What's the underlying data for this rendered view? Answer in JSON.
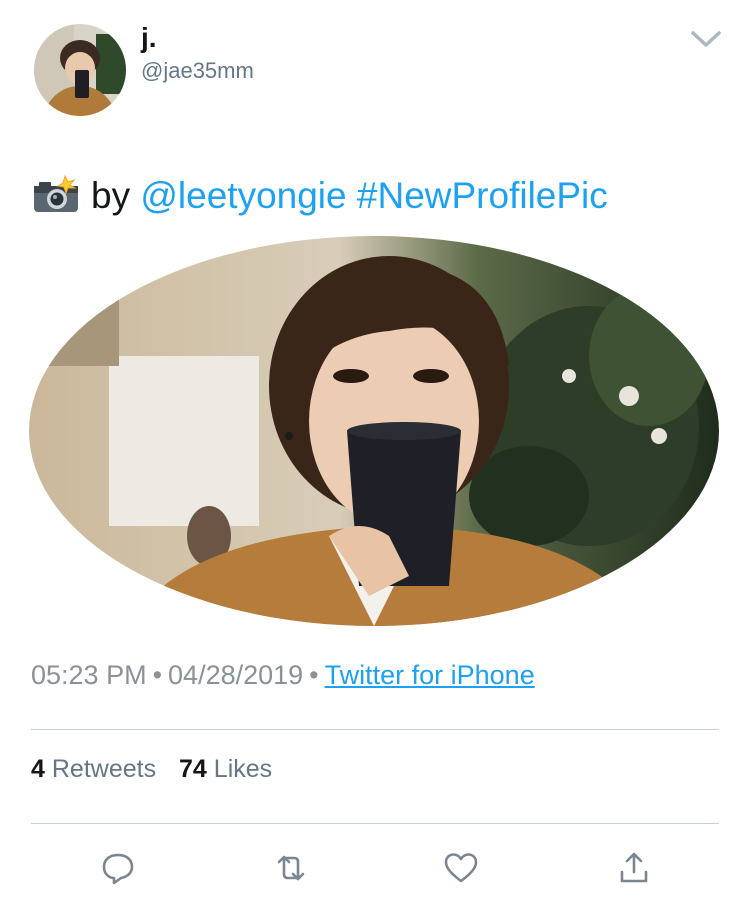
{
  "user": {
    "display_name": "j.",
    "handle": "@jae35mm"
  },
  "tweet": {
    "emoji": "camera-with-flash",
    "by_text": "by",
    "mention": "@leetyongie",
    "hashtag": "#NewProfilePic"
  },
  "meta": {
    "time": "05:23 PM",
    "separator": "•",
    "date": "04/28/2019",
    "source": "Twitter for iPhone"
  },
  "stats": {
    "retweets_count": "4",
    "retweets_label": "Retweets",
    "likes_count": "74",
    "likes_label": "Likes"
  },
  "actions": {
    "icons": [
      "reply-icon",
      "retweet-icon",
      "like-icon",
      "share-icon"
    ]
  },
  "colors": {
    "link": "#1da1f2",
    "secondary_text": "#657786",
    "divider": "#c8cfd5",
    "icon": "#7a8793"
  }
}
